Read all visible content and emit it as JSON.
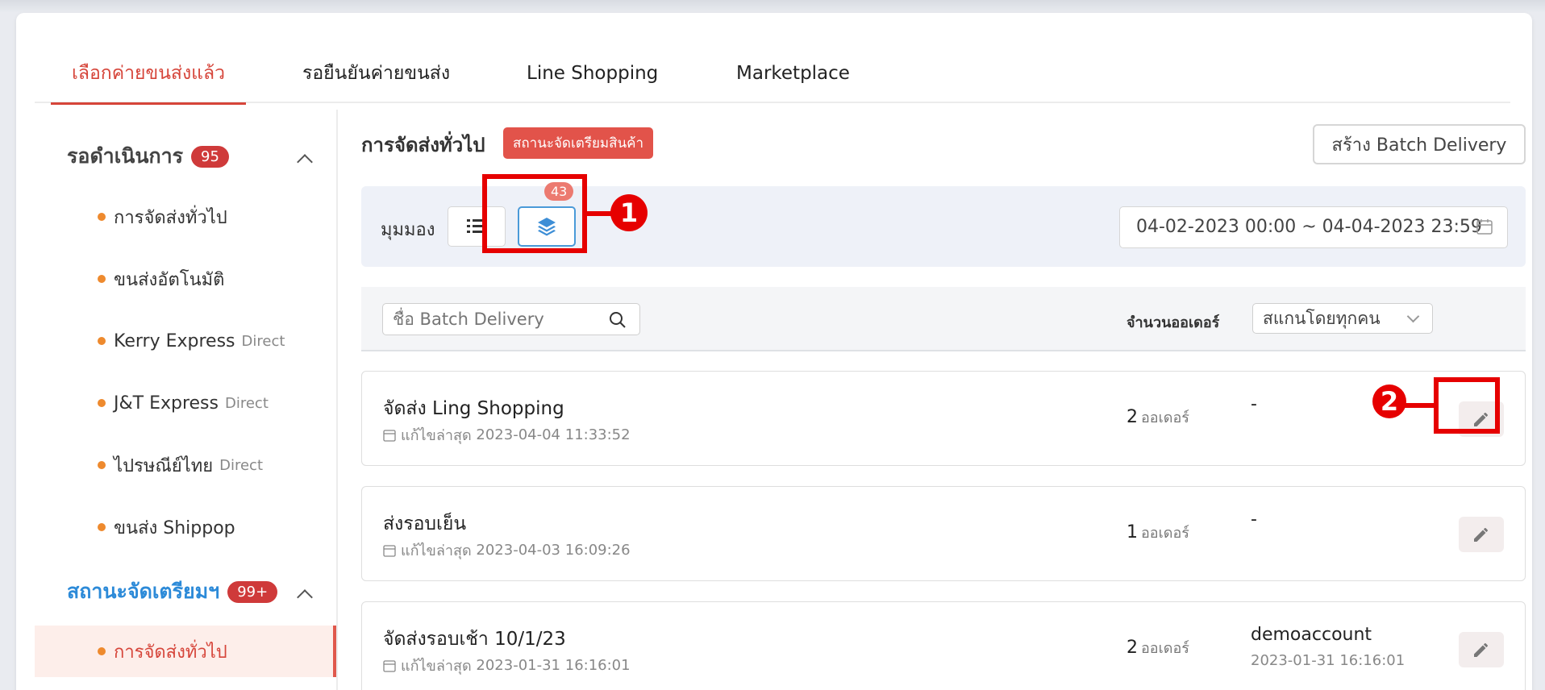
{
  "tabs": [
    {
      "label": "เลือกค่ายขนส่งแล้ว"
    },
    {
      "label": "รอยืนยันค่ายขนส่ง"
    },
    {
      "label": "Line Shopping"
    },
    {
      "label": "Marketplace"
    }
  ],
  "sidebar": {
    "group1": {
      "label": "รอดำเนินการ",
      "count": "95"
    },
    "items": [
      {
        "label": "การจัดส่งทั่วไป",
        "sub": ""
      },
      {
        "label": "ขนส่งอัตโนมัติ",
        "sub": ""
      },
      {
        "label": "Kerry Express",
        "sub": "Direct"
      },
      {
        "label": "J&T Express",
        "sub": "Direct"
      },
      {
        "label": "ไปรษณีย์ไทย",
        "sub": "Direct"
      },
      {
        "label": "ขนส่ง Shippop",
        "sub": ""
      }
    ],
    "group2": {
      "label": "สถานะจัดเตรียมฯ",
      "count": "99+"
    },
    "active_item": {
      "label": "การจัดส่งทั่วไป"
    }
  },
  "main": {
    "title": "การจัดส่งทั่วไป",
    "status_tag": "สถานะจัดเตรียมสินค้า",
    "create_button": "สร้าง Batch Delivery",
    "view_label": "มุมมอง",
    "batch_count": "43",
    "date_range": "04-02-2023 00:00 ~ 04-04-2023 23:59",
    "search_placeholder": "ชื่อ Batch Delivery",
    "order_label": "จำนวนออเดอร์",
    "scan_select": "สแกนโดยทุกคน",
    "order_unit": "ออเดอร์",
    "time_prefix": "แก้ไขล่าสุด",
    "rows": [
      {
        "name": "จัดส่ง Ling Shopping",
        "time": "2023-04-04 11:33:52",
        "count": "2",
        "by": "-",
        "by_time": ""
      },
      {
        "name": "ส่งรอบเย็น",
        "time": "2023-04-03 16:09:26",
        "count": "1",
        "by": "-",
        "by_time": ""
      },
      {
        "name": "จัดส่งรอบเช้า 10/1/23",
        "time": "2023-01-31 16:16:01",
        "count": "2",
        "by": "demoaccount",
        "by_time": "2023-01-31 16:16:01"
      }
    ]
  },
  "annotations": {
    "one": "1",
    "two": "2"
  },
  "colors": {
    "accent_red": "#d6453a",
    "blue": "#2c8ad8",
    "dot_orange": "#ee8a2e",
    "annotation_red": "#e60000"
  }
}
